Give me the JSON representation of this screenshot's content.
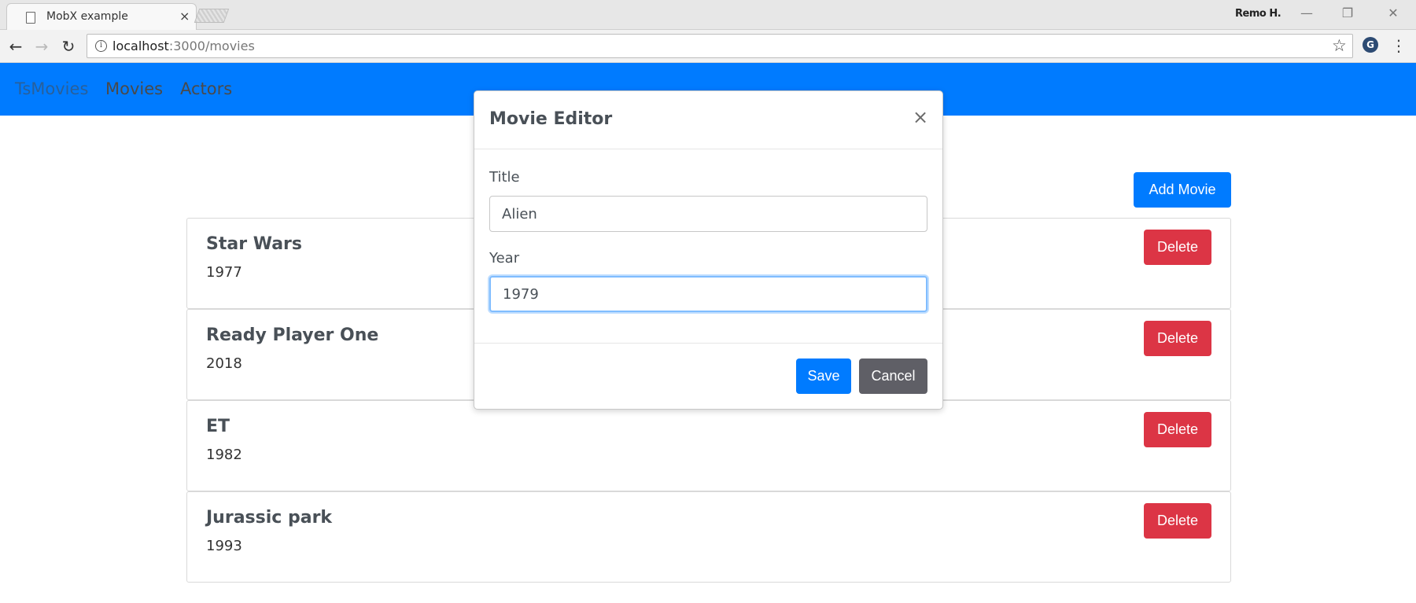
{
  "browser": {
    "tab_title": "MobX example",
    "tab_close": "×",
    "profile_name": "Remo H.",
    "url_host": "localhost",
    "url_path": ":3000/movies",
    "window_controls": {
      "minimize": "—",
      "restore": "❐",
      "close": "✕"
    },
    "icons": {
      "back": "←",
      "forward": "→",
      "reload": "↻",
      "info": "i",
      "star": "☆",
      "extension": "G",
      "menu": "⋮"
    }
  },
  "navbar": {
    "brand": "TsMovies",
    "links": [
      "Movies",
      "Actors"
    ],
    "accent_color": "#007bff"
  },
  "main": {
    "add_button_label": "Add Movie",
    "delete_label": "Delete",
    "movies": [
      {
        "title": "Star Wars",
        "year": "1977"
      },
      {
        "title": "Ready Player One",
        "year": "2018"
      },
      {
        "title": "ET",
        "year": "1982"
      },
      {
        "title": "Jurassic park",
        "year": "1993"
      }
    ]
  },
  "modal": {
    "title": "Movie Editor",
    "close_glyph": "×",
    "title_label": "Title",
    "title_value": "Alien",
    "year_label": "Year",
    "year_value": "1979",
    "save_label": "Save",
    "cancel_label": "Cancel"
  },
  "colors": {
    "primary": "#007bff",
    "danger": "#dc3545",
    "secondary": "#5f5f66"
  }
}
